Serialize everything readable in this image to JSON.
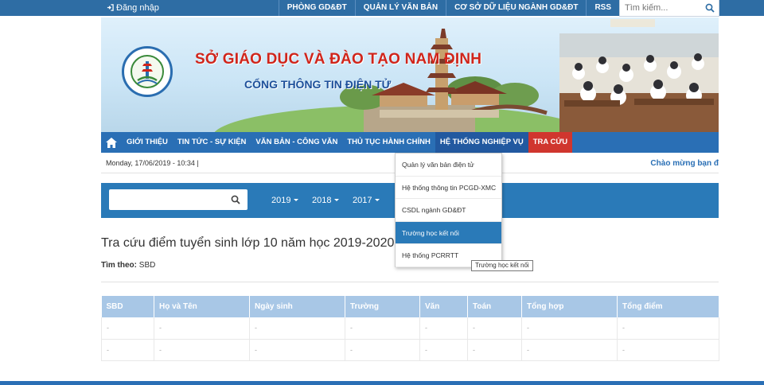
{
  "topbar": {
    "login_label": "Đăng nhập",
    "links": [
      "PHÒNG GD&ĐT",
      "QUẢN LÝ VĂN BẢN",
      "CƠ SỞ DỮ LIỆU NGÀNH GD&ĐT",
      "RSS"
    ],
    "search_placeholder": "Tìm kiếm..."
  },
  "banner": {
    "title": "SỞ GIÁO DỤC VÀ ĐÀO TẠO NAM ĐỊNH",
    "subtitle": "CỔNG THÔNG TIN ĐIỆN TỬ"
  },
  "nav": {
    "items": [
      "GIỚI THIỆU",
      "TIN TỨC - SỰ KIỆN",
      "VĂN BẢN - CÔNG VĂN",
      "THỦ TỤC HÀNH CHÍNH",
      "HỆ THỐNG NGHIỆP VỤ",
      "TRA CỨU"
    ]
  },
  "datebar": {
    "date": "Monday, 17/06/2019 - 10:34   |",
    "welcome": "Chào mừng bạn đ"
  },
  "filter": {
    "years": [
      "2019",
      "2018",
      "2017"
    ]
  },
  "page": {
    "title": "Tra cứu điểm tuyển sinh lớp 10 năm học 2019-2020",
    "search_by_label": "Tìm theo:",
    "search_by_value": "SBD"
  },
  "table": {
    "headers": [
      "SBD",
      "Họ và Tên",
      "Ngày sinh",
      "Trường",
      "Văn",
      "Toán",
      "Tổng hợp",
      "Tổng điểm"
    ],
    "rows": [
      [
        "-",
        "-",
        "-",
        "-",
        "-",
        "-",
        "-",
        "-"
      ],
      [
        "-",
        "-",
        "-",
        "-",
        "-",
        "-",
        "-",
        "-"
      ]
    ]
  },
  "dropdown": {
    "items": [
      "Quản lý văn bản điện tử",
      "Hệ thống thông tin PCGD-XMC",
      "CSDL ngành GD&ĐT",
      "Trường học kết nối",
      "Hệ thống PCRRTT"
    ],
    "active_index": 3,
    "tooltip": "Trường học kết nối"
  },
  "colors": {
    "primary": "#2a6fb5",
    "topbar": "#2e6da4",
    "table_header": "#a8c7e6",
    "banner_title": "#d0251b",
    "banner_subtitle": "#1d4f9a"
  }
}
